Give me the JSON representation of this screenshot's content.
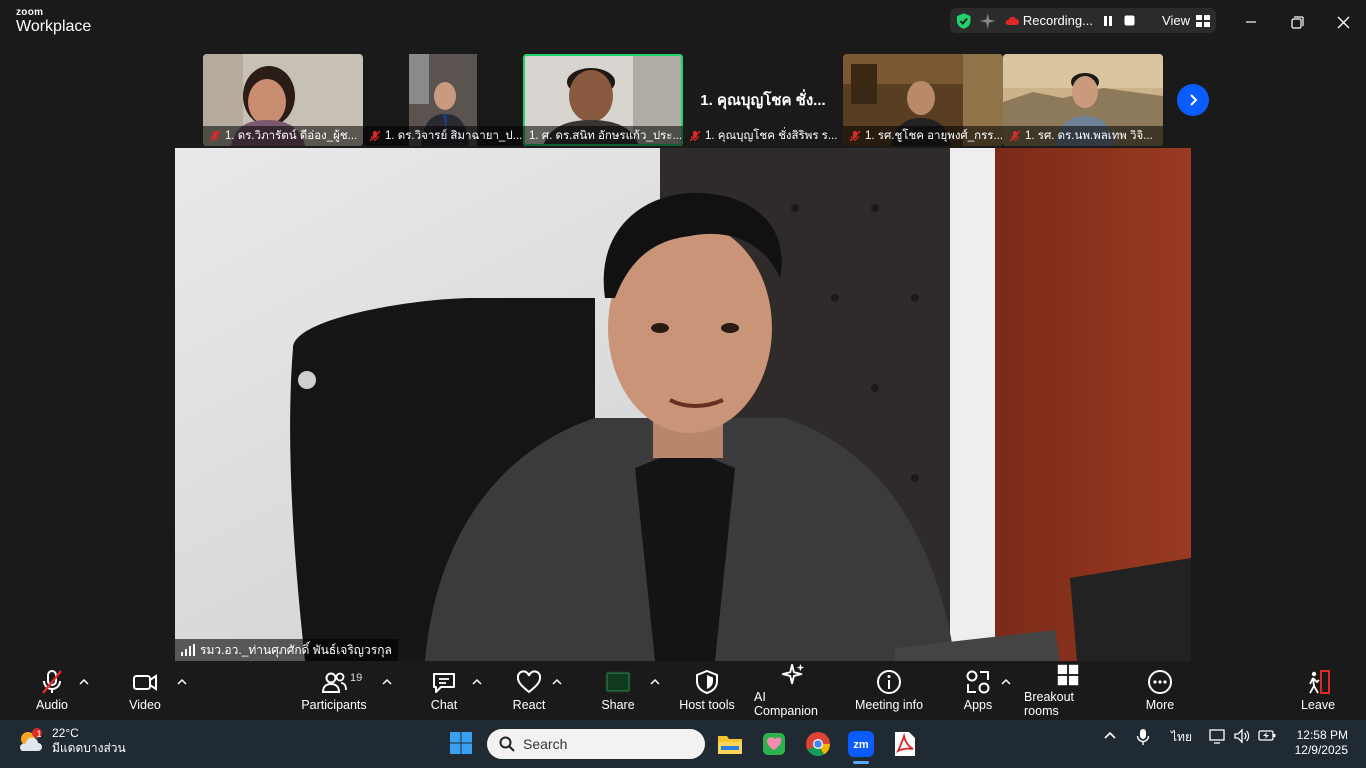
{
  "titlebar": {
    "brand_small": "zoom",
    "brand_product": "Workplace",
    "recording_label": "Recording...",
    "view_label": "View"
  },
  "thumbnails": [
    {
      "label": "1. ดร.วิภารัตน์ ดีอ่อง_ผู้ช..."
    },
    {
      "label": "1. ดร.วิจารย์ สิมาฉายา_ป..."
    },
    {
      "label": "1. ศ. ดร.สนิท อักษรแก้ว_ประ..."
    },
    {
      "label": "1. คุณบุญโชค ชั่งสิริพร ร...",
      "center_name": "1. คุณบุญโชค ชั่ง..."
    },
    {
      "label": "1. รศ.ชูโชค อายุพงศ์_กรร..."
    },
    {
      "label": "1. รศ. ดร.นพ.พลเทพ วิจิ..."
    }
  ],
  "main_speaker": {
    "label": "รมว.อว._ท่านศุภศักดิ์ พันธ์เจริญวรกุล"
  },
  "controls": {
    "audio": "Audio",
    "video": "Video",
    "participants": "Participants",
    "participants_count": "19",
    "chat": "Chat",
    "react": "React",
    "share": "Share",
    "host_tools": "Host tools",
    "ai_companion": "AI Companion",
    "meeting_info": "Meeting info",
    "apps": "Apps",
    "breakout_rooms": "Breakout rooms",
    "more": "More",
    "leave": "Leave"
  },
  "taskbar": {
    "weather_temp": "22°C",
    "weather_desc": "มีแดดบางส่วน",
    "weather_badge": "1",
    "search_placeholder": "Search",
    "language": "ไทย",
    "time": "12:58 PM",
    "date": "12/9/2025"
  },
  "colors": {
    "accent_green": "#1fd36b",
    "accent_blue": "#0b5cff",
    "leave_red": "#e02828"
  }
}
